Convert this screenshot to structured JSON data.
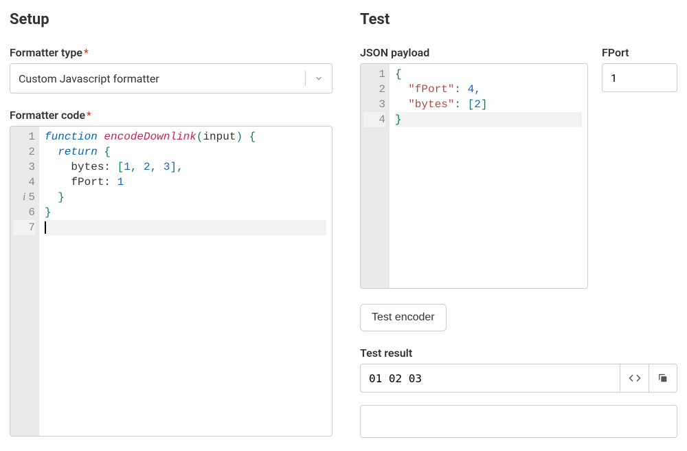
{
  "setup": {
    "heading": "Setup",
    "formatter_type_label": "Formatter type",
    "formatter_type_value": "Custom Javascript formatter",
    "formatter_code_label": "Formatter code",
    "code_lines": [
      [
        {
          "t": "function",
          "c": "kw"
        },
        {
          "t": " ",
          "c": ""
        },
        {
          "t": "encodeDownlink",
          "c": "fn"
        },
        {
          "t": "(",
          "c": "punct"
        },
        {
          "t": "input",
          "c": "ident"
        },
        {
          "t": ") {",
          "c": "punct"
        }
      ],
      [
        {
          "t": "  ",
          "c": ""
        },
        {
          "t": "return",
          "c": "kw"
        },
        {
          "t": " {",
          "c": "punct"
        }
      ],
      [
        {
          "t": "    bytes: ",
          "c": "ident"
        },
        {
          "t": "[",
          "c": "punct"
        },
        {
          "t": "1",
          "c": "num"
        },
        {
          "t": ", ",
          "c": "punct"
        },
        {
          "t": "2",
          "c": "num"
        },
        {
          "t": ", ",
          "c": "punct"
        },
        {
          "t": "3",
          "c": "num"
        },
        {
          "t": "],",
          "c": "punct"
        }
      ],
      [
        {
          "t": "    fPort: ",
          "c": "ident"
        },
        {
          "t": "1",
          "c": "num"
        }
      ],
      [
        {
          "t": "  }",
          "c": "punct"
        }
      ],
      [
        {
          "t": "}",
          "c": "punct"
        }
      ],
      [
        {
          "t": "",
          "c": ""
        }
      ]
    ],
    "gutter": [
      "1",
      "2",
      "3",
      "4",
      "5",
      "6",
      "7"
    ],
    "info_line_index": 4,
    "active_line_index": 6
  },
  "test": {
    "heading": "Test",
    "json_label": "JSON payload",
    "fport_label": "FPort",
    "fport_value": "1",
    "json_gutter": [
      "1",
      "2",
      "3",
      "4"
    ],
    "json_active_line_index": 3,
    "json_lines": [
      [
        {
          "t": "{",
          "c": "punct"
        }
      ],
      [
        {
          "t": "  ",
          "c": ""
        },
        {
          "t": "\"fPort\"",
          "c": "str-key"
        },
        {
          "t": ": ",
          "c": "punct"
        },
        {
          "t": "4",
          "c": "num"
        },
        {
          "t": ",",
          "c": "punct"
        }
      ],
      [
        {
          "t": "  ",
          "c": ""
        },
        {
          "t": "\"bytes\"",
          "c": "str-key"
        },
        {
          "t": ": [",
          "c": "punct"
        },
        {
          "t": "2",
          "c": "num"
        },
        {
          "t": "]",
          "c": "punct"
        }
      ],
      [
        {
          "t": "}",
          "c": "punct"
        }
      ]
    ],
    "test_encoder_label": "Test encoder",
    "test_result_label": "Test result",
    "test_result_value": "01 02 03"
  }
}
